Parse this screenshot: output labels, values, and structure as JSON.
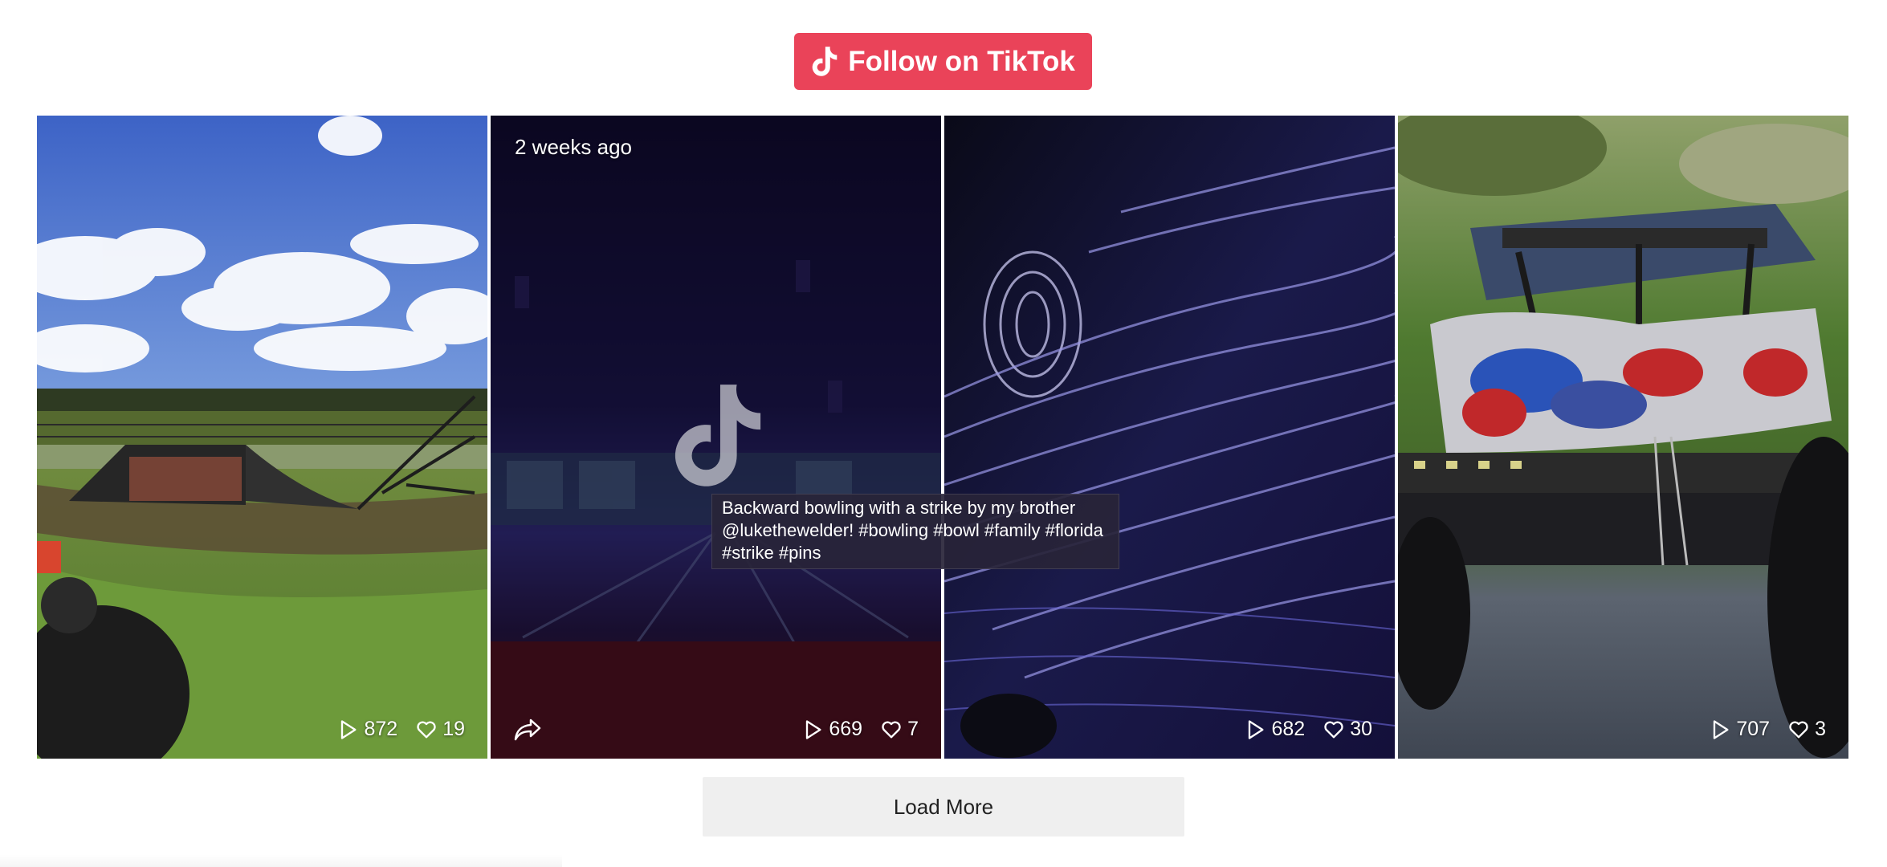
{
  "header": {
    "follow_label": "Follow on TikTok"
  },
  "videos": [
    {
      "plays": "872",
      "likes": "19"
    },
    {
      "plays": "669",
      "likes": "7",
      "date": "2 weeks ago",
      "caption": "Backward bowling with a strike by my brother @lukethewelder!  #bowling  #bowl  #family  #florida  #strike  #pins"
    },
    {
      "plays": "682",
      "likes": "30"
    },
    {
      "plays": "707",
      "likes": "3"
    }
  ],
  "footer": {
    "load_more_label": "Load More"
  },
  "colors": {
    "accent": "#ea4359",
    "load_more_bg": "#efefef"
  },
  "icons": [
    "tiktok-logo-icon",
    "play-icon",
    "heart-icon",
    "share-icon"
  ]
}
